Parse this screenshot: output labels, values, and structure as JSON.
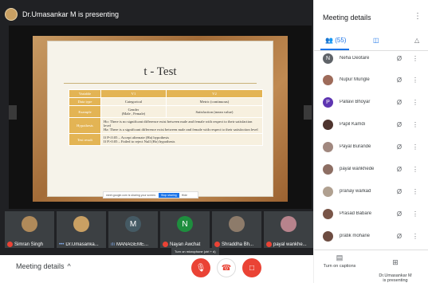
{
  "presenter": {
    "banner": "Dr.Umasankar M is presenting"
  },
  "slide": {
    "title": "t - Test",
    "table": {
      "header": [
        "Variable",
        "V1",
        "V2"
      ],
      "rows": [
        {
          "label": "Data type",
          "c1": "Categorical",
          "c2": "Metric (continuous)"
        },
        {
          "label": "Example",
          "c1": "Gender\n(Male , Female)",
          "c2": "Satisfaction (mean value)"
        }
      ],
      "hypothesis_label": "Hypothesis",
      "hypothesis_text": "Ho: There is no significant difference exist between male and female with respect to their satisfaction level\nHa: There is a significant difference exist between male and female with respect to their satisfaction level",
      "test_label": "Test result",
      "test_text": "If P<0.05 – Accept alternate (Ha) hypothesis\nIf P>0.05 – Failed to reject Null (Ho) hypothesis"
    },
    "popup_text": "meet.google.com is sharing your screen.",
    "popup_button": "Stop sharing",
    "popup_hide": "Hide"
  },
  "tiles": [
    {
      "name": "Simran Singh",
      "initial": "",
      "color": "#b08a5a",
      "muted": true
    },
    {
      "name": "Dr.Umasanka...",
      "initial": "",
      "color": "#c9a063",
      "muted": false
    },
    {
      "name": "MANAGEME...",
      "initial": "M",
      "color": "#455a64",
      "muted": false
    },
    {
      "name": "Nayan Awchat",
      "initial": "N",
      "color": "#1e8e3e",
      "muted": true
    },
    {
      "name": "Shraddha Bh...",
      "initial": "",
      "color": "#8d7b6a",
      "muted": true
    },
    {
      "name": "payal wankhe...",
      "initial": "",
      "color": "#b7838c",
      "muted": true
    }
  ],
  "tooltip": "Turn on microphone (ctrl + d)",
  "bottom": {
    "meeting_details": "Meeting details"
  },
  "panel": {
    "title": "Meeting details",
    "people_count": "(55)",
    "participants": [
      {
        "name": "Neha Deotare",
        "initial": "N",
        "color": "#5f6368"
      },
      {
        "name": "Nupur Mungle",
        "initial": "",
        "color": "#9e6b5a"
      },
      {
        "name": "Pallavi Bhoyar",
        "initial": "P",
        "color": "#5e35b1"
      },
      {
        "name": "Papil Kamdi",
        "initial": "",
        "color": "#4e342e"
      },
      {
        "name": "Payal Burande",
        "initial": "",
        "color": "#a1887f"
      },
      {
        "name": "payal wankhede",
        "initial": "",
        "color": "#8d6e63"
      },
      {
        "name": "pranay warkad",
        "initial": "",
        "color": "#b0a090"
      },
      {
        "name": "Prasad Babare",
        "initial": "",
        "color": "#795548"
      },
      {
        "name": "pratik moharie",
        "initial": "",
        "color": "#6d4c41"
      }
    ],
    "captions": "Turn on captions",
    "presenting": "Dr.Umasankar M\nis presenting"
  }
}
